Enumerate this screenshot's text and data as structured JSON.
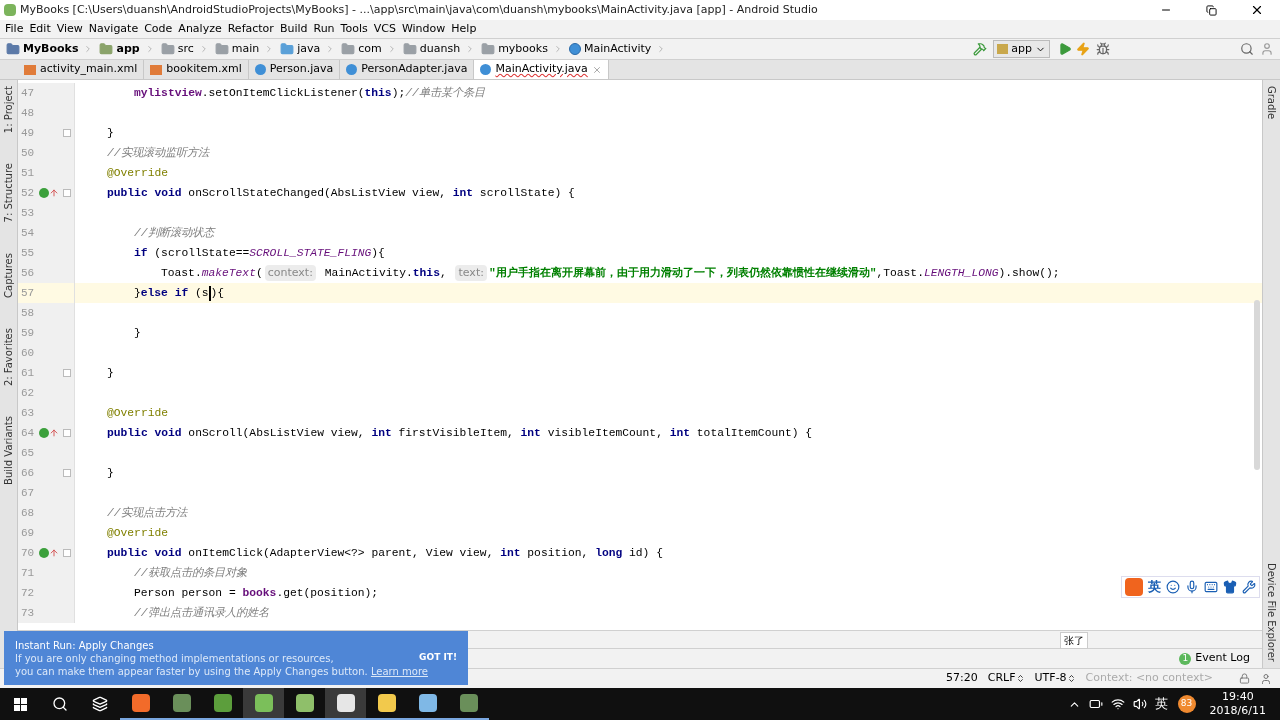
{
  "window": {
    "title": "MyBooks [C:\\Users\\duansh\\AndroidStudioProjects\\MyBooks] - ...\\app\\src\\main\\java\\com\\duansh\\mybooks\\MainActivity.java [app] - Android Studio"
  },
  "menu": [
    "File",
    "Edit",
    "View",
    "Navigate",
    "Code",
    "Analyze",
    "Refactor",
    "Build",
    "Run",
    "Tools",
    "VCS",
    "Window",
    "Help"
  ],
  "breadcrumbs": [
    {
      "label": "MyBooks",
      "kind": "project"
    },
    {
      "label": "app",
      "kind": "module"
    },
    {
      "label": "src",
      "kind": "folder"
    },
    {
      "label": "main",
      "kind": "folder"
    },
    {
      "label": "java",
      "kind": "source"
    },
    {
      "label": "com",
      "kind": "folder"
    },
    {
      "label": "duansh",
      "kind": "folder"
    },
    {
      "label": "mybooks",
      "kind": "folder"
    },
    {
      "label": "MainActivity",
      "kind": "class"
    }
  ],
  "run_config": {
    "label": "app"
  },
  "tabs": [
    {
      "label": "activity_main.xml",
      "kind": "xml",
      "selected": false
    },
    {
      "label": "bookitem.xml",
      "kind": "xml",
      "selected": false
    },
    {
      "label": "Person.java",
      "kind": "java",
      "selected": false
    },
    {
      "label": "PersonAdapter.java",
      "kind": "java",
      "selected": false
    },
    {
      "label": "MainActivity.java",
      "kind": "java",
      "selected": true
    }
  ],
  "left_tool_strip": [
    "1: Project",
    "7: Structure",
    "Captures",
    "2: Favorites",
    "Build Variants"
  ],
  "right_tool_strip": [
    "Gradle",
    "Device File Explorer"
  ],
  "editor": {
    "lines": [
      {
        "number": "47",
        "override": false,
        "fold": false,
        "current": false,
        "kind": "body",
        "tokens": [
          {
            "kind": "field",
            "text": "mylistview"
          },
          {
            "kind": "plain",
            "text": ".setOnItemClickListener("
          },
          {
            "kind": "kw",
            "text": "this"
          },
          {
            "kind": "plain",
            "text": ");"
          },
          {
            "kind": "comment",
            "text": "//单击某个条目"
          }
        ]
      },
      {
        "number": "48",
        "override": false,
        "fold": false,
        "current": false
      },
      {
        "number": "49",
        "override": false,
        "fold": true,
        "current": false,
        "kind": "member",
        "tokens": [
          {
            "kind": "plain",
            "text": "}"
          }
        ]
      },
      {
        "number": "50",
        "override": false,
        "fold": false,
        "current": false,
        "kind": "member",
        "tokens": [
          {
            "kind": "comment",
            "text": "//实现滚动监听方法"
          }
        ]
      },
      {
        "number": "51",
        "override": false,
        "fold": false,
        "current": false,
        "kind": "member",
        "tokens": [
          {
            "kind": "annot",
            "text": "@Override"
          }
        ]
      },
      {
        "number": "52",
        "override": true,
        "fold": true,
        "current": false,
        "kind": "member",
        "tokens": [
          {
            "kind": "kw",
            "text": "public void"
          },
          {
            "kind": "plain",
            "text": " onScrollStateChanged(AbsListView view, "
          },
          {
            "kind": "kw",
            "text": "int"
          },
          {
            "kind": "plain",
            "text": " scrollState) {"
          }
        ]
      },
      {
        "number": "53",
        "override": false,
        "fold": false,
        "current": false
      },
      {
        "number": "54",
        "override": false,
        "fold": false,
        "current": false,
        "kind": "body",
        "tokens": [
          {
            "kind": "comment",
            "text": "//判断滚动状态"
          }
        ]
      },
      {
        "number": "55",
        "override": false,
        "fold": false,
        "current": false,
        "kind": "body",
        "tokens": [
          {
            "kind": "kw",
            "text": "if"
          },
          {
            "kind": "plain",
            "text": " (scrollState=="
          },
          {
            "kind": "static",
            "text": "SCROLL_STATE_FLING"
          },
          {
            "kind": "plain",
            "text": "){"
          }
        ]
      },
      {
        "number": "56",
        "override": false,
        "fold": false,
        "current": false,
        "kind": "nested",
        "tokens": [
          {
            "kind": "plain",
            "text": "Toast."
          },
          {
            "kind": "static",
            "text": "makeText"
          },
          {
            "kind": "plain",
            "text": "("
          },
          {
            "kind": "hint",
            "text": "context:"
          },
          {
            "kind": "plain",
            "text": " MainActivity."
          },
          {
            "kind": "kw",
            "text": "this"
          },
          {
            "kind": "plain",
            "text": ", "
          },
          {
            "kind": "hint",
            "text": "text:"
          },
          {
            "kind": "string",
            "text": "\"用户手指在离开屏幕前，由于用力滑动了一下，列表仍然依靠惯性在继续滑动\""
          },
          {
            "kind": "plain",
            "text": ",Toast."
          },
          {
            "kind": "static",
            "text": "LENGTH_LONG"
          },
          {
            "kind": "plain",
            "text": ").show();"
          }
        ]
      },
      {
        "number": "57",
        "override": false,
        "fold": false,
        "current": true,
        "kind": "body",
        "tokens": [
          {
            "kind": "plain",
            "text": "}"
          },
          {
            "kind": "kw",
            "text": "else if"
          },
          {
            "kind": "plain",
            "text": " (s"
          },
          {
            "kind": "caret"
          },
          {
            "kind": "plain",
            "text": "){"
          }
        ]
      },
      {
        "number": "58",
        "override": false,
        "fold": false,
        "current": false
      },
      {
        "number": "59",
        "override": false,
        "fold": false,
        "current": false,
        "kind": "body",
        "tokens": [
          {
            "kind": "plain",
            "text": "}"
          }
        ]
      },
      {
        "number": "60",
        "override": false,
        "fold": false,
        "current": false
      },
      {
        "number": "61",
        "override": false,
        "fold": true,
        "current": false,
        "kind": "member",
        "tokens": [
          {
            "kind": "plain",
            "text": "}"
          }
        ]
      },
      {
        "number": "62",
        "override": false,
        "fold": false,
        "current": false
      },
      {
        "number": "63",
        "override": false,
        "fold": false,
        "current": false,
        "kind": "member",
        "tokens": [
          {
            "kind": "annot",
            "text": "@Override"
          }
        ]
      },
      {
        "number": "64",
        "override": true,
        "fold": true,
        "current": false,
        "kind": "member",
        "tokens": [
          {
            "kind": "kw",
            "text": "public void"
          },
          {
            "kind": "plain",
            "text": " onScroll(AbsListView view, "
          },
          {
            "kind": "kw",
            "text": "int"
          },
          {
            "kind": "plain",
            "text": " firstVisibleItem, "
          },
          {
            "kind": "kw",
            "text": "int"
          },
          {
            "kind": "plain",
            "text": " visibleItemCount, "
          },
          {
            "kind": "kw",
            "text": "int"
          },
          {
            "kind": "plain",
            "text": " totalItemCount) {"
          }
        ]
      },
      {
        "number": "65",
        "override": false,
        "fold": false,
        "current": false
      },
      {
        "number": "66",
        "override": false,
        "fold": true,
        "current": false,
        "kind": "member",
        "tokens": [
          {
            "kind": "plain",
            "text": "}"
          }
        ]
      },
      {
        "number": "67",
        "override": false,
        "fold": false,
        "current": false
      },
      {
        "number": "68",
        "override": false,
        "fold": false,
        "current": false,
        "kind": "member",
        "tokens": [
          {
            "kind": "comment",
            "text": "//实现点击方法"
          }
        ]
      },
      {
        "number": "69",
        "override": false,
        "fold": false,
        "current": false,
        "kind": "member",
        "tokens": [
          {
            "kind": "annot",
            "text": "@Override"
          }
        ]
      },
      {
        "number": "70",
        "override": true,
        "fold": true,
        "current": false,
        "kind": "member",
        "tokens": [
          {
            "kind": "kw",
            "text": "public void"
          },
          {
            "kind": "plain",
            "text": " onItemClick(AdapterView<?> parent, View view, "
          },
          {
            "kind": "kw",
            "text": "int"
          },
          {
            "kind": "plain",
            "text": " position, "
          },
          {
            "kind": "kw",
            "text": "long"
          },
          {
            "kind": "plain",
            "text": " id) {"
          }
        ]
      },
      {
        "number": "71",
        "override": false,
        "fold": false,
        "current": false,
        "kind": "body",
        "tokens": [
          {
            "kind": "comment",
            "text": "//获取点击的条目对象"
          }
        ]
      },
      {
        "number": "72",
        "override": false,
        "fold": false,
        "current": false,
        "kind": "body",
        "tokens": [
          {
            "kind": "plain",
            "text": "Person person = "
          },
          {
            "kind": "field",
            "text": "books"
          },
          {
            "kind": "plain",
            "text": ".get(position);"
          }
        ]
      },
      {
        "number": "73",
        "override": false,
        "fold": false,
        "current": false,
        "kind": "body",
        "tokens": [
          {
            "kind": "comment",
            "text": "//弹出点击通讯录人的姓名"
          }
        ]
      }
    ]
  },
  "ime_toolbar": {
    "label": "英"
  },
  "ime_candidate": "张了",
  "notification": {
    "title": "Instant Run: Apply Changes",
    "lines": [
      "If you are only changing method implementations or resources,",
      "you can make them appear faster by using the Apply Changes button."
    ],
    "link": "Learn more",
    "action": "GOT IT!"
  },
  "event_log": {
    "label": "Event Log",
    "count": "1"
  },
  "status_bar": {
    "position": "57:20",
    "line_separator": "CRLF",
    "encoding": "UTF-8",
    "context": "Context: <no context>"
  },
  "taskbar": {
    "apps": [
      {
        "kind": "slides",
        "selected": false
      },
      {
        "kind": "sheet",
        "selected": false
      },
      {
        "kind": "book",
        "selected": false
      },
      {
        "kind": "android",
        "selected": true
      },
      {
        "kind": "image",
        "selected": false
      },
      {
        "kind": "globe",
        "selected": true
      },
      {
        "kind": "folder",
        "selected": false
      },
      {
        "kind": "notes",
        "selected": false
      },
      {
        "kind": "sheet-error",
        "selected": false
      }
    ],
    "ime": "英",
    "badge": "83",
    "time": "19:40",
    "date": "2018/6/11"
  }
}
